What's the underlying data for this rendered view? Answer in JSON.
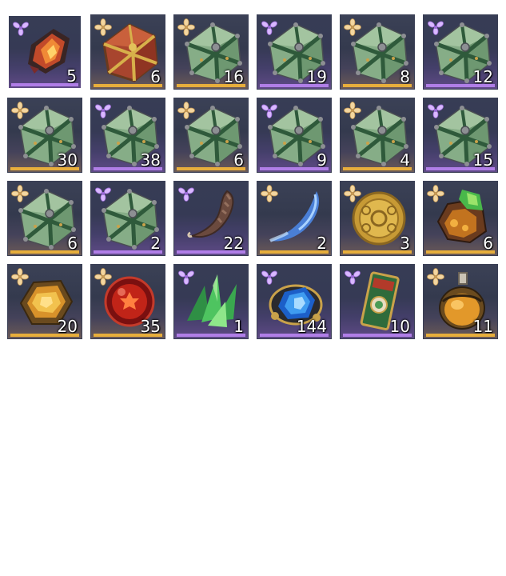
{
  "inventory": {
    "slots": [
      {
        "item": "fire-ore",
        "rarity": "purple",
        "count": "5",
        "selected": true
      },
      {
        "item": "red-gold-dice-box",
        "rarity": "gold",
        "count": "6"
      },
      {
        "item": "green-dice-box",
        "rarity": "gold",
        "count": "16"
      },
      {
        "item": "green-dice-box",
        "rarity": "purple",
        "count": "19"
      },
      {
        "item": "green-dice-box",
        "rarity": "gold",
        "count": "8"
      },
      {
        "item": "green-dice-box",
        "rarity": "purple",
        "count": "12"
      },
      {
        "item": "green-dice-box",
        "rarity": "gold",
        "count": "30"
      },
      {
        "item": "green-dice-box",
        "rarity": "purple",
        "count": "38"
      },
      {
        "item": "green-dice-box",
        "rarity": "gold",
        "count": "6"
      },
      {
        "item": "green-dice-box",
        "rarity": "purple",
        "count": "9"
      },
      {
        "item": "green-dice-box",
        "rarity": "gold",
        "count": "4"
      },
      {
        "item": "green-dice-box",
        "rarity": "purple",
        "count": "15"
      },
      {
        "item": "green-dice-box",
        "rarity": "gold",
        "count": "6"
      },
      {
        "item": "green-dice-box",
        "rarity": "purple",
        "count": "2"
      },
      {
        "item": "brown-claw",
        "rarity": "purple",
        "count": "22"
      },
      {
        "item": "blue-feather-blade",
        "rarity": "gold",
        "count": "2"
      },
      {
        "item": "gold-coin",
        "rarity": "gold",
        "count": "3"
      },
      {
        "item": "green-gem-ore",
        "rarity": "gold",
        "count": "6"
      },
      {
        "item": "amber-gem",
        "rarity": "gold",
        "count": "20"
      },
      {
        "item": "red-orb",
        "rarity": "gold",
        "count": "35"
      },
      {
        "item": "green-crystal-shards",
        "rarity": "purple",
        "count": "1"
      },
      {
        "item": "blue-gem-ornament",
        "rarity": "purple",
        "count": "144"
      },
      {
        "item": "green-talisman",
        "rarity": "purple",
        "count": "10"
      },
      {
        "item": "amber-potion",
        "rarity": "gold",
        "count": "11"
      }
    ]
  },
  "colors": {
    "gold_rarity": "#e7ae3c",
    "purple_rarity": "#b07ee7",
    "slot_border": "#3a3f55",
    "selected_border": "#ffffff",
    "page_background": "#ffffff"
  }
}
